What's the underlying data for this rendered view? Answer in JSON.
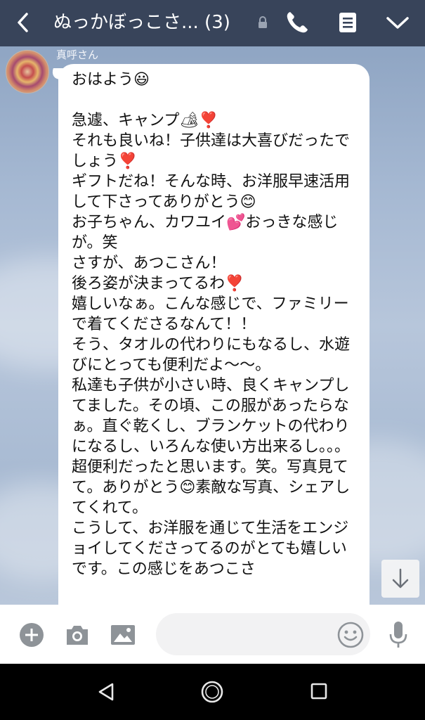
{
  "header": {
    "title": "ぬっかぼっこさ... (3)",
    "icons": [
      "back-icon",
      "lock-icon",
      "phone-icon",
      "notes-icon",
      "chevron-down-icon"
    ]
  },
  "chat": {
    "sender_name": "真呼さん",
    "message": "おはよう😃\n\n急遽、キャンプ🏕❣️\nそれも良いね！子供達は大喜びだったでしょう❣️\nギフトだね！そんな時、お洋服早速活用して下さってありがとう😊\nお子ちゃん、カワユイ💕おっきな感じが。笑\nさすが、あつこさん！\n後ろ姿が決まってるわ❣️\n嬉しいなぁ。こんな感じで、ファミリーで着てくださるなんて！！\nそう、タオルの代わりにもなるし、水遊びにとっても便利だよ〜〜。\n私達も子供が小さい時、良くキャンプしてました。その頃、この服があったらなぁ。直ぐ乾くし、ブランケットの代わりになるし、いろんな使い方出来るし。。。\n超便利だったと思います。笑。写真見てて。ありがとう😊素敵な写真、シェアしてくれて。\nこうして、お洋服を通じて生活をエンジョイしてくださってるのがとても嬉しいです。この感じをあつこさ"
  },
  "input": {
    "placeholder": "",
    "icons": [
      "plus-circle-icon",
      "camera-icon",
      "image-icon",
      "emoji-icon",
      "microphone-icon"
    ]
  },
  "colors": {
    "header_bg": "#38445a",
    "icon_gray": "#8e9398",
    "bubble_bg": "#ffffff"
  }
}
